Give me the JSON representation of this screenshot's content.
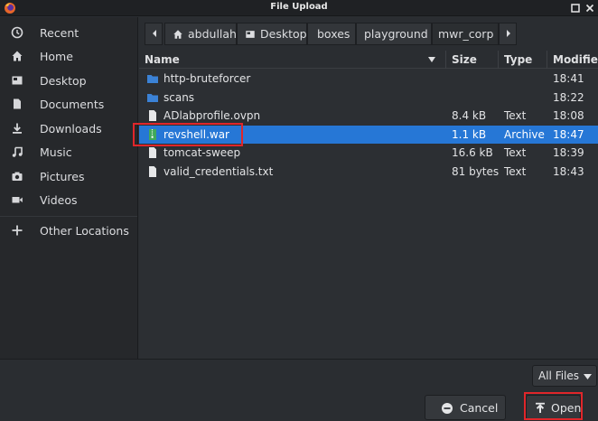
{
  "window": {
    "title": "File Upload"
  },
  "sidebar": {
    "items": [
      {
        "label": "Recent",
        "icon": "clock-icon"
      },
      {
        "label": "Home",
        "icon": "home-icon"
      },
      {
        "label": "Desktop",
        "icon": "desktop-icon"
      },
      {
        "label": "Documents",
        "icon": "document-icon"
      },
      {
        "label": "Downloads",
        "icon": "download-icon"
      },
      {
        "label": "Music",
        "icon": "music-note-icon"
      },
      {
        "label": "Pictures",
        "icon": "camera-icon"
      },
      {
        "label": "Videos",
        "icon": "video-camera-icon"
      },
      {
        "label": "Other Locations",
        "icon": "plus-icon"
      }
    ]
  },
  "pathbar": {
    "crumbs": [
      "abdullah",
      "Desktop",
      "boxes",
      "playground",
      "mwr_corp"
    ],
    "active": "mwr_corp"
  },
  "columns": [
    "Name",
    "Size",
    "Type",
    "Modified"
  ],
  "files": [
    {
      "name": "http-bruteforcer",
      "size": "",
      "type": "",
      "modified": "18:41",
      "kind": "folder"
    },
    {
      "name": "scans",
      "size": "",
      "type": "",
      "modified": "18:22",
      "kind": "folder"
    },
    {
      "name": "ADlabprofile.ovpn",
      "size": "8.4 kB",
      "type": "Text",
      "modified": "18:08",
      "kind": "file"
    },
    {
      "name": "revshell.war",
      "size": "1.1 kB",
      "type": "Archive",
      "modified": "18:47",
      "kind": "archive",
      "selected": true
    },
    {
      "name": "tomcat-sweep",
      "size": "16.6 kB",
      "type": "Text",
      "modified": "18:39",
      "kind": "file"
    },
    {
      "name": "valid_credentials.txt",
      "size": "81 bytes",
      "type": "Text",
      "modified": "18:43",
      "kind": "file"
    }
  ],
  "footer": {
    "filter_label": "All Files",
    "cancel_label": "Cancel",
    "open_label": "Open"
  },
  "colors": {
    "selection": "#2677d6",
    "folder": "#3b82d6",
    "highlight_box": "#e0262a"
  }
}
